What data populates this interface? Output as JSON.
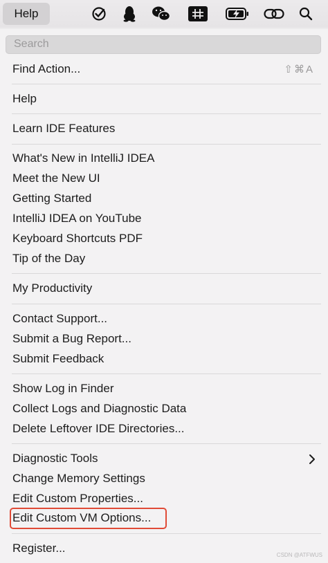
{
  "menubar": {
    "title": "Help",
    "icons": [
      "todo-check-icon",
      "qq-penguin-icon",
      "wechat-icon",
      "input-method-icon",
      "battery-charging-icon",
      "link-icon",
      "search-icon"
    ]
  },
  "menu": {
    "search_placeholder": "Search",
    "find_action": {
      "label": "Find Action...",
      "shortcut": "⇧⌘A"
    },
    "items": {
      "help": "Help",
      "learn": "Learn IDE Features",
      "whats_new": "What's New in IntelliJ IDEA",
      "meet_new_ui": "Meet the New UI",
      "getting_started": "Getting Started",
      "youtube": "IntelliJ IDEA on YouTube",
      "shortcuts_pdf": "Keyboard Shortcuts PDF",
      "tip": "Tip of the Day",
      "productivity": "My Productivity",
      "contact": "Contact Support...",
      "bug": "Submit a Bug Report...",
      "feedback": "Submit Feedback",
      "show_log": "Show Log in Finder",
      "collect_logs": "Collect Logs and Diagnostic Data",
      "delete_dirs": "Delete Leftover IDE Directories...",
      "diag_tools": "Diagnostic Tools",
      "memory": "Change Memory Settings",
      "custom_props": "Edit Custom Properties...",
      "vm_options": "Edit Custom VM Options...",
      "register": "Register..."
    }
  },
  "watermark": "CSDN @ATFWUS",
  "colors": {
    "highlight": "#e04a36"
  }
}
